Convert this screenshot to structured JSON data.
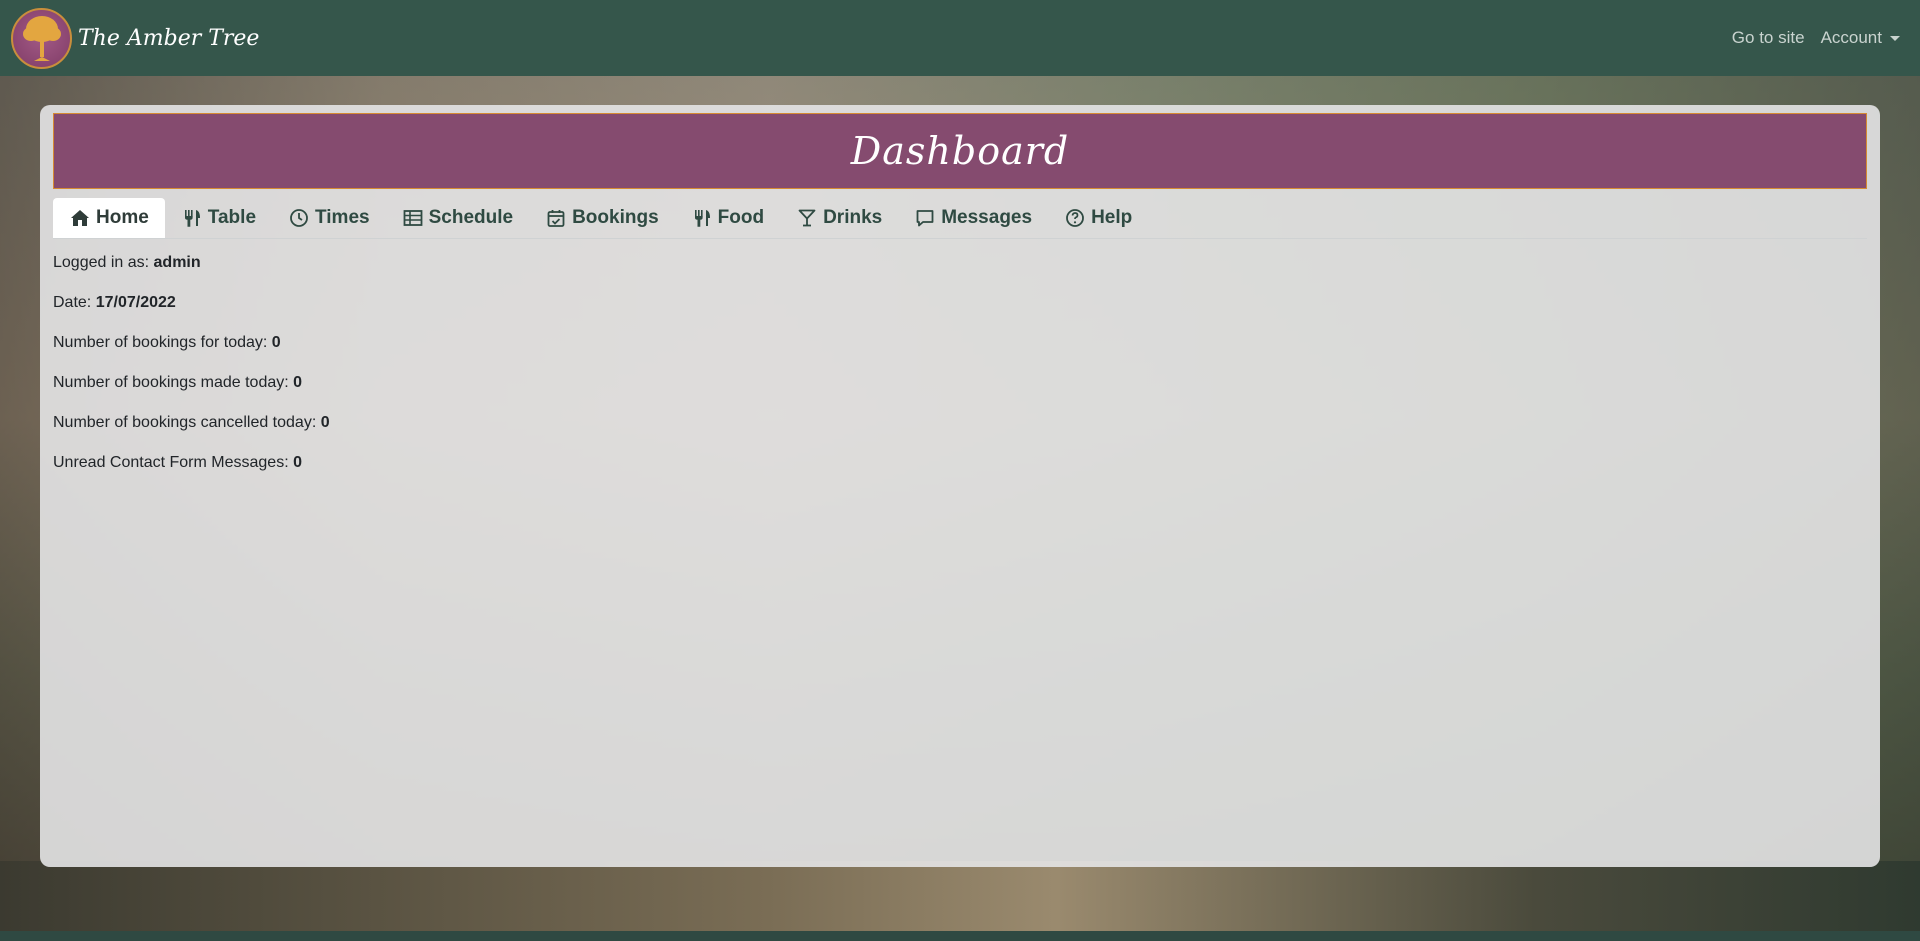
{
  "navbar": {
    "brand_name": "The Amber Tree",
    "go_to_site": "Go to site",
    "account": "Account"
  },
  "header": {
    "title": "Dashboard"
  },
  "tabs": [
    {
      "label": "Home",
      "icon": "home-icon",
      "active": true
    },
    {
      "label": "Table",
      "icon": "utensils-icon"
    },
    {
      "label": "Times",
      "icon": "clock-icon"
    },
    {
      "label": "Schedule",
      "icon": "table-icon"
    },
    {
      "label": "Bookings",
      "icon": "calendar-check-icon"
    },
    {
      "label": "Food",
      "icon": "utensils-icon"
    },
    {
      "label": "Drinks",
      "icon": "cocktail-icon"
    },
    {
      "label": "Messages",
      "icon": "message-icon"
    },
    {
      "label": "Help",
      "icon": "question-circle-icon"
    }
  ],
  "info": {
    "logged_in_label": "Logged in as:",
    "logged_in_value": "admin",
    "date_label": "Date:",
    "date_value": "17/07/2022",
    "bookings_today_label": "Number of bookings for today:",
    "bookings_today_value": "0",
    "bookings_made_label": "Number of bookings made today:",
    "bookings_made_value": "0",
    "bookings_cancelled_label": "Number of bookings cancelled today:",
    "bookings_cancelled_value": "0",
    "unread_messages_label": "Unread Contact Form Messages:",
    "unread_messages_value": "0"
  },
  "colors": {
    "navbar": "#35564b",
    "banner": "#854b6f",
    "banner_border": "#d68a33",
    "tab_text": "#2f4a42"
  }
}
